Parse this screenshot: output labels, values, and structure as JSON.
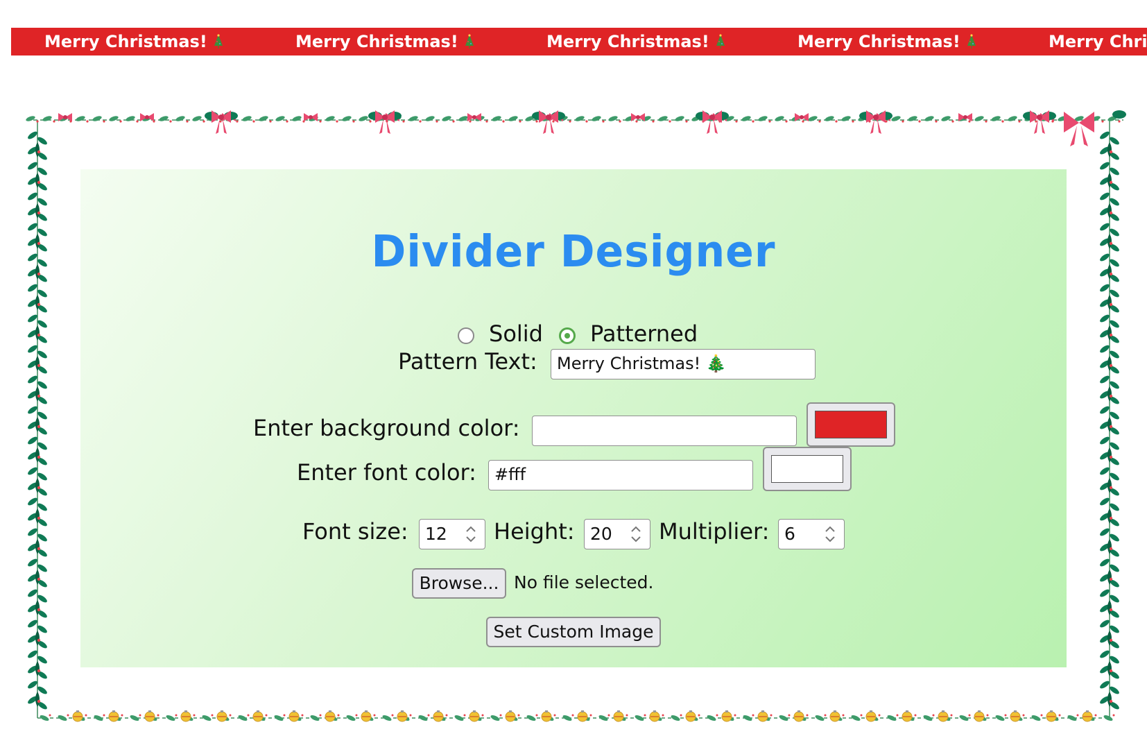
{
  "banner": {
    "text": "Merry Christmas!",
    "emoji_icon": "christmas-tree-icon",
    "background_color": "#df2426",
    "font_color": "#ffffff"
  },
  "title": "Divider Designer",
  "divider_type": {
    "options": [
      "Solid",
      "Patterned"
    ],
    "selected": "Patterned"
  },
  "pattern": {
    "label": "Pattern Text:",
    "value": "Merry Christmas! 🎄"
  },
  "background_color": {
    "label": "Enter background color:",
    "value": "",
    "swatch": "#df2426"
  },
  "font_color": {
    "label": "Enter font color:",
    "value": "#fff",
    "swatch": "#ffffff"
  },
  "numbers": {
    "font_size_label": "Font size:",
    "font_size": "12",
    "height_label": "Height:",
    "height": "20",
    "multiplier_label": "Multiplier:",
    "multiplier": "6"
  },
  "file": {
    "browse_label": "Browse...",
    "status": "No file selected."
  },
  "set_custom_image_label": "Set Custom Image",
  "colors": {
    "title": "#2b8cf0",
    "holly_leaf": "#0f7a55",
    "bow": "#e84a6f",
    "radio_selected": "#55a94b"
  }
}
